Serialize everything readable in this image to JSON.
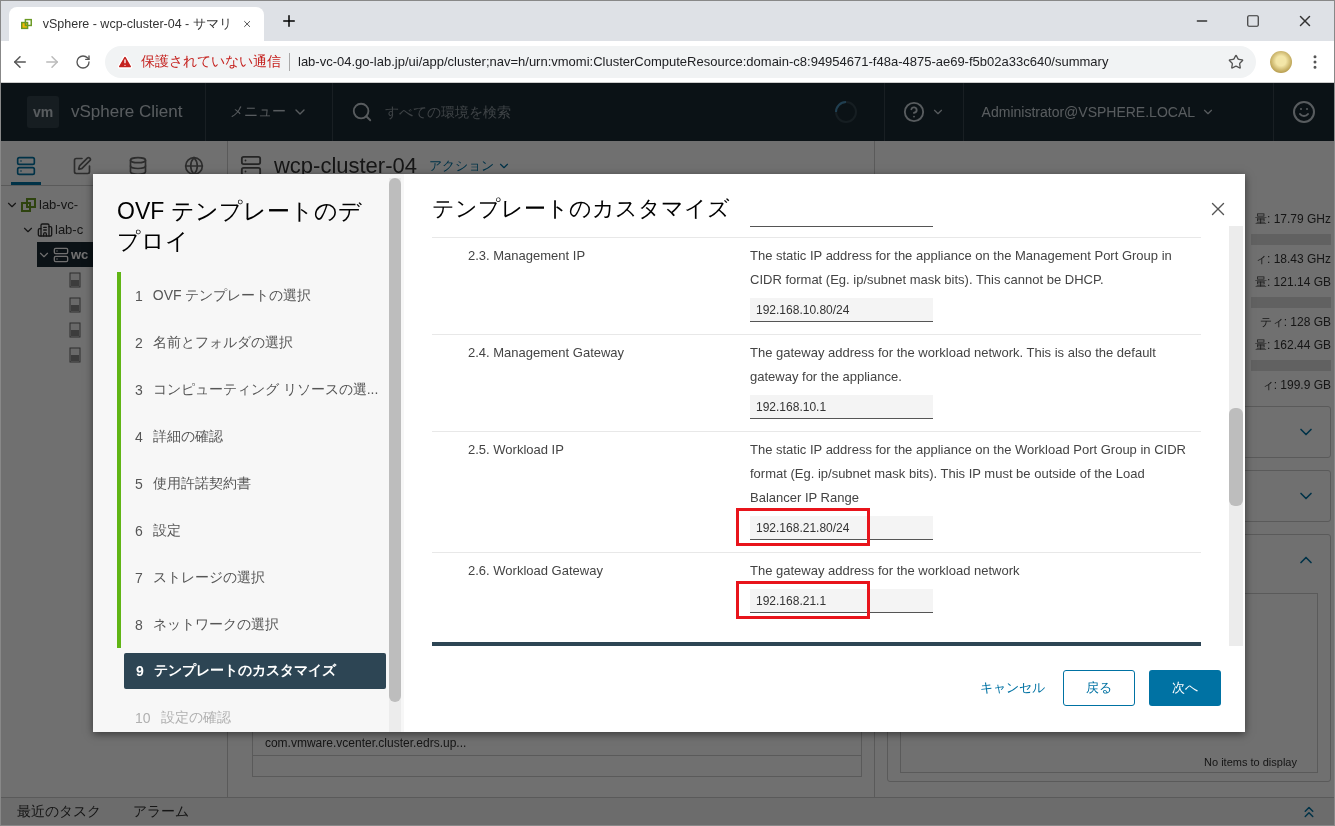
{
  "browser": {
    "tab_title": "vSphere - wcp-cluster-04 - サマリ",
    "security_label": "保護されていない通信",
    "url": "lab-vc-04.go-lab.jp/ui/app/cluster;nav=h/urn:vmomi:ClusterComputeResource:domain-c8:94954671-f48a-4875-ae69-f5b02a33c640/summary"
  },
  "header": {
    "logo": "vm",
    "app_name": "vSphere Client",
    "menu": "メニュー",
    "search_placeholder": "すべての環境を検索",
    "user": "Administrator@VSPHERE.LOCAL"
  },
  "navigator": {
    "tabs": [
      {
        "kind": "hosts",
        "selected": true
      },
      {
        "kind": "vms",
        "selected": false
      },
      {
        "kind": "storage",
        "selected": false
      },
      {
        "kind": "network",
        "selected": false
      }
    ],
    "tree": [
      {
        "label": "lab-vc-",
        "kind": "vcenter",
        "expanded": true,
        "selected": false,
        "children": [
          {
            "label": "lab-c",
            "kind": "datacenter",
            "expanded": true,
            "selected": false,
            "children": [
              {
                "label": "wc",
                "kind": "cluster",
                "expanded": true,
                "selected": true,
                "children": [
                  {
                    "kind": "host",
                    "selected": false
                  },
                  {
                    "kind": "host",
                    "selected": false
                  },
                  {
                    "kind": "host",
                    "selected": false
                  },
                  {
                    "kind": "host",
                    "selected": false
                  }
                ]
              }
            ]
          }
        ]
      }
    ]
  },
  "content": {
    "title": "wcp-cluster-04",
    "actions": "アクション",
    "table_rows": [
      "com.vmware.vcenter.cluster.edrs.up..."
    ]
  },
  "summary": {
    "stats": [
      "量: 17.79 GHz",
      "ィ: 18.43 GHz",
      "量: 121.14 GB",
      "ティ: 128 GB",
      "量: 162.44 GB",
      "ィ: 199.9 GB"
    ],
    "cards": [
      {
        "expanded": false
      },
      {
        "expanded": false
      },
      {
        "expanded": true,
        "empty_text": "No items to display"
      }
    ]
  },
  "bottom_bar": {
    "tabs": [
      "最近のタスク",
      "アラーム"
    ]
  },
  "dialog": {
    "title": "OVF テンプレートのデプロイ",
    "page_title": "テンプレートのカスタマイズ",
    "steps": [
      {
        "number": "1",
        "label": "OVF テンプレートの選択",
        "completed": true,
        "selected": false,
        "disabled": false
      },
      {
        "number": "2",
        "label": "名前とフォルダの選択",
        "completed": true,
        "selected": false,
        "disabled": false
      },
      {
        "number": "3",
        "label": "コンピューティング リソースの選...",
        "completed": true,
        "selected": false,
        "disabled": false
      },
      {
        "number": "4",
        "label": "詳細の確認",
        "completed": true,
        "selected": false,
        "disabled": false
      },
      {
        "number": "5",
        "label": "使用許諾契約書",
        "completed": true,
        "selected": false,
        "disabled": false
      },
      {
        "number": "6",
        "label": "設定",
        "completed": true,
        "selected": false,
        "disabled": false
      },
      {
        "number": "7",
        "label": "ストレージの選択",
        "completed": true,
        "selected": false,
        "disabled": false
      },
      {
        "number": "8",
        "label": "ネットワークの選択",
        "completed": true,
        "selected": false,
        "disabled": false
      },
      {
        "number": "9",
        "label": "テンプレートのカスタマイズ",
        "completed": false,
        "selected": true,
        "disabled": false
      },
      {
        "number": "10",
        "label": "設定の確認",
        "completed": false,
        "selected": false,
        "disabled": true
      }
    ],
    "properties": [
      {
        "label": "2.3. Management IP",
        "description": "The static IP address for the appliance on the Management Port Group in CIDR format (Eg. ip/subnet mask bits). This cannot be DHCP.",
        "value": "192.168.10.80/24",
        "highlighted": false
      },
      {
        "label": "2.4. Management Gateway",
        "description": "The gateway address for the workload network. This is also the default gateway for the appliance.",
        "value": "192.168.10.1",
        "highlighted": false
      },
      {
        "label": "2.5. Workload IP",
        "description": "The static IP address for the appliance on the Workload Port Group in CIDR format (Eg. ip/subnet mask bits). This IP must be outside of the Load Balancer IP Range",
        "value": "192.168.21.80/24",
        "highlighted": true
      },
      {
        "label": "2.6. Workload Gateway",
        "description": "The gateway address for the workload network",
        "value": "192.168.21.1",
        "highlighted": true
      }
    ],
    "buttons": {
      "cancel": "キャンセル",
      "back": "戻る",
      "next": "次へ"
    }
  }
}
